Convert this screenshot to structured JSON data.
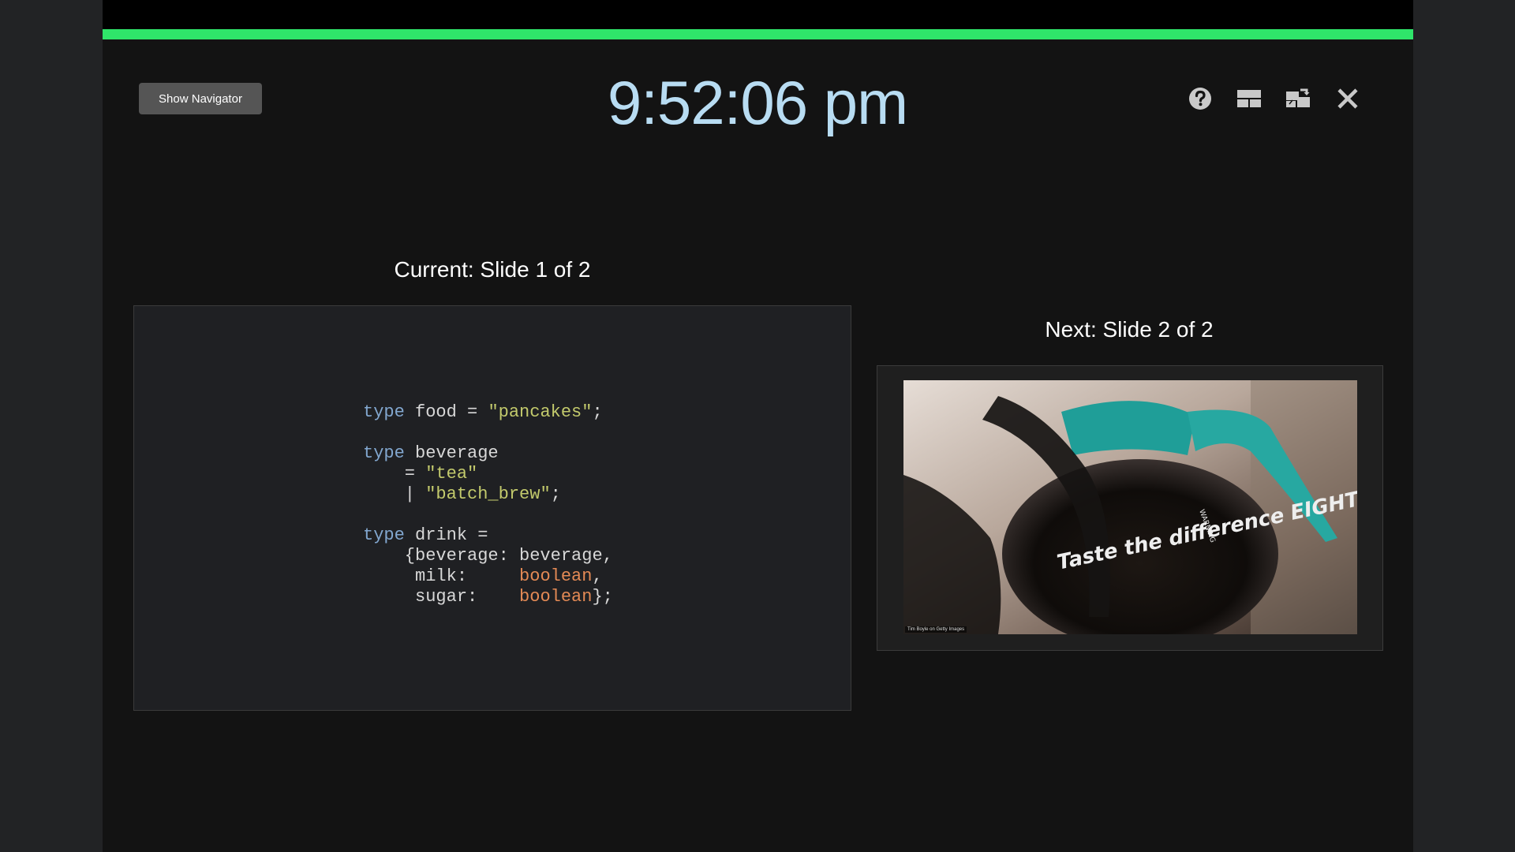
{
  "toolbar": {
    "show_navigator_label": "Show Navigator",
    "icons": [
      "help-icon",
      "layout-icon",
      "swap-displays-icon",
      "close-icon"
    ]
  },
  "clock": {
    "time": "9:52:06 pm"
  },
  "progress": {
    "fraction": 1.0,
    "color": "#2fe56a"
  },
  "current": {
    "label": "Current: Slide 1 of 2",
    "code_lines": [
      [
        {
          "t": "kw",
          "v": "type"
        },
        {
          "t": "pl",
          "v": " food = "
        },
        {
          "t": "str",
          "v": "\"pancakes\""
        },
        {
          "t": "pl",
          "v": ";"
        }
      ],
      [],
      [
        {
          "t": "kw",
          "v": "type"
        },
        {
          "t": "pl",
          "v": " beverage"
        }
      ],
      [
        {
          "t": "pl",
          "v": "    = "
        },
        {
          "t": "str",
          "v": "\"tea\""
        }
      ],
      [
        {
          "t": "pl",
          "v": "    | "
        },
        {
          "t": "str",
          "v": "\"batch_brew\""
        },
        {
          "t": "pl",
          "v": ";"
        }
      ],
      [],
      [
        {
          "t": "kw",
          "v": "type"
        },
        {
          "t": "pl",
          "v": " drink ="
        }
      ],
      [
        {
          "t": "pl",
          "v": "    {beverage: beverage,"
        }
      ],
      [
        {
          "t": "pl",
          "v": "     milk:     "
        },
        {
          "t": "ty",
          "v": "boolean"
        },
        {
          "t": "pl",
          "v": ","
        }
      ],
      [
        {
          "t": "pl",
          "v": "     sugar:    "
        },
        {
          "t": "ty",
          "v": "boolean"
        },
        {
          "t": "pl",
          "v": "};"
        }
      ]
    ]
  },
  "next": {
    "label": "Next: Slide 2 of 2",
    "photo_caption": "Taste the difference EIGHT O'CLOCK COFFEE",
    "photo_credit": "Tim Boyle on Getty Images",
    "photo_warning": "WARNING"
  },
  "colors": {
    "accent_progress": "#2fe56a",
    "clock_text": "#b8dcf2",
    "keyword": "#82a7cf",
    "string": "#c3ca6c",
    "type": "#e48a55"
  }
}
